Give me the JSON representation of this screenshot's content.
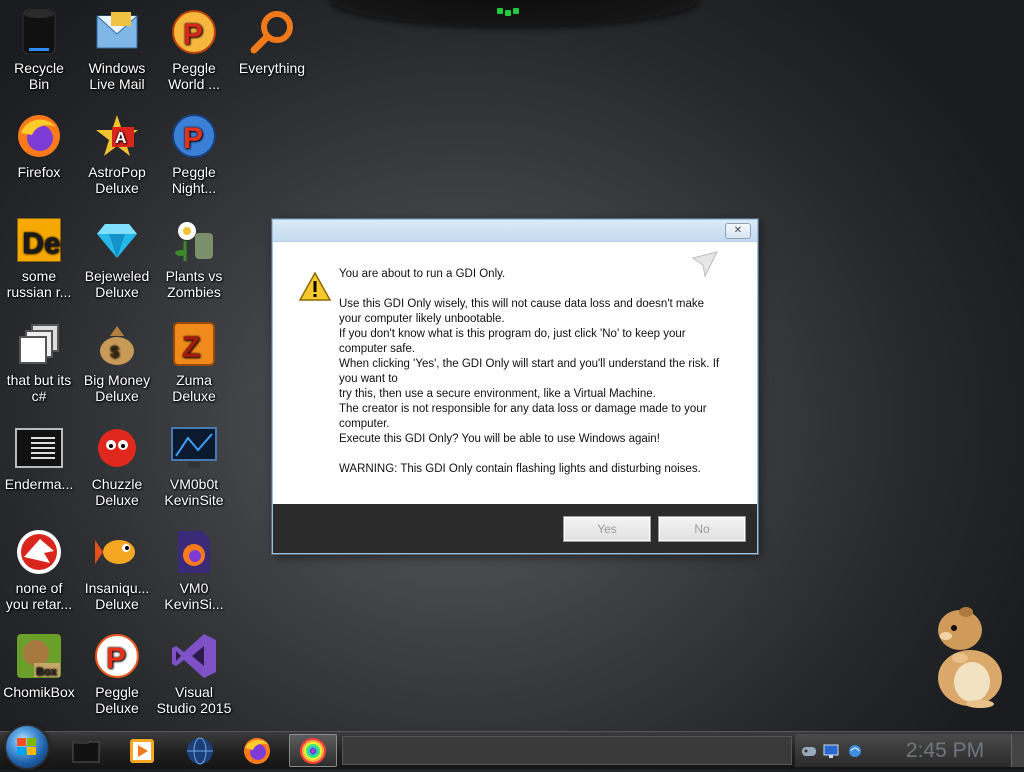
{
  "desktop_icons": [
    {
      "label": "Recycle\nBin",
      "icon": "recycle-bin-icon"
    },
    {
      "label": "Windows\nLive Mail",
      "icon": "mail-icon"
    },
    {
      "label": "Peggle\nWorld ...",
      "icon": "peggle-icon"
    },
    {
      "label": "Everything",
      "icon": "search-icon"
    },
    {
      "label": "Firefox",
      "icon": "firefox-icon"
    },
    {
      "label": "AstroPop\nDeluxe",
      "icon": "astropop-icon"
    },
    {
      "label": "Peggle\nNight...",
      "icon": "peggle-icon"
    },
    {
      "label": "some\nrussian r...",
      "icon": "de-icon"
    },
    {
      "label": "Bejeweled\nDeluxe",
      "icon": "gem-icon"
    },
    {
      "label": "Plants vs\nZombies",
      "icon": "plant-icon"
    },
    {
      "label": "that but its\nc#",
      "icon": "copy-icon"
    },
    {
      "label": "Big Money\nDeluxe",
      "icon": "money-bag-icon"
    },
    {
      "label": "Zuma\nDeluxe",
      "icon": "zuma-icon"
    },
    {
      "label": "Enderma...",
      "icon": "terminal-icon"
    },
    {
      "label": "Chuzzle\nDeluxe",
      "icon": "chuzzle-icon"
    },
    {
      "label": "VM0b0t\nKevinSite",
      "icon": "monitor-icon"
    },
    {
      "label": "none of\nyou retar...",
      "icon": "shark-icon"
    },
    {
      "label": "Insaniqu...\nDeluxe",
      "icon": "fish-icon"
    },
    {
      "label": "VM0\nKevinSi...",
      "icon": "firefox-file-icon"
    },
    {
      "label": "ChomikBox",
      "icon": "chomik-icon"
    },
    {
      "label": "Peggle\nDeluxe",
      "icon": "peggle-icon"
    },
    {
      "label": "Visual\nStudio 2015",
      "icon": "visual-studio-icon"
    }
  ],
  "dialog": {
    "heading": "You are about to run a GDI Only.",
    "lines": [
      "Use this GDI Only wisely, this will not cause data loss and doesn't make your computer likely unbootable.",
      "If you don't know what is this program do, just click 'No' to keep your computer safe.",
      "When clicking 'Yes', the GDI Only will start and you'll understand the risk. If you want to",
      "try this, then use a secure environment, like a Virtual Machine.",
      "The creator is not responsible for any data loss or damage made to your computer.",
      "Execute this GDI Only? You will be able to use Windows again!"
    ],
    "warning": "WARNING: This GDI Only contain flashing lights and disturbing noises.",
    "yes_label": "Yes",
    "no_label": "No",
    "close_label": "✕"
  },
  "taskbar": {
    "items": [
      "explorer-icon",
      "media-player-icon",
      "globe-icon",
      "firefox-icon",
      "rainbow-app-icon"
    ],
    "active_index": 4,
    "clock": "2:45 PM"
  }
}
